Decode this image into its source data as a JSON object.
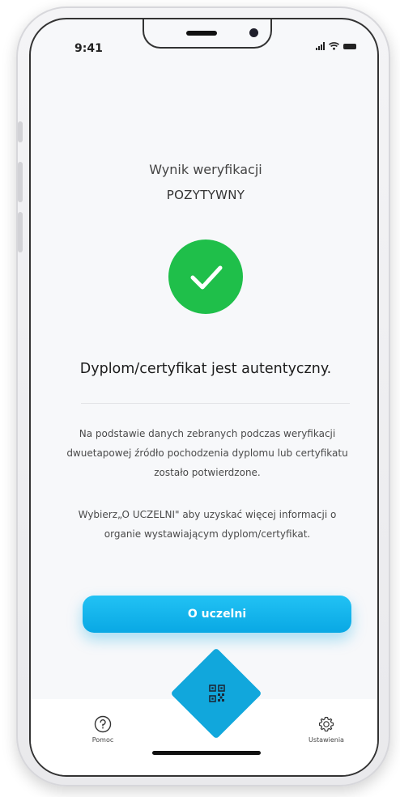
{
  "status_bar": {
    "time": "9:41"
  },
  "verification": {
    "title": "Wynik weryfikacji",
    "status": "POZYTYWNY",
    "status_color": "#1fbf4a",
    "headline": "Dyplom/certyfikat jest autentyczny.",
    "description_1": "Na podstawie danych zebranych podczas weryfikacji dwuetapowej źródło pochodzenia dyplomu lub certyfikatu zostało potwierdzone.",
    "description_2": "Wybierz„O UCZELNI\" aby uzyskać więcej informacji o organie wystawiającym dyplom/certyfikat."
  },
  "actions": {
    "university_button_label": "O uczelni",
    "accent_color": "#0aaae4"
  },
  "tabbar": {
    "help_label": "Pomoc",
    "help_icon": "question-circle-icon",
    "settings_label": "Ustawienia",
    "settings_icon": "gear-icon",
    "scan_icon": "qr-code-icon"
  }
}
